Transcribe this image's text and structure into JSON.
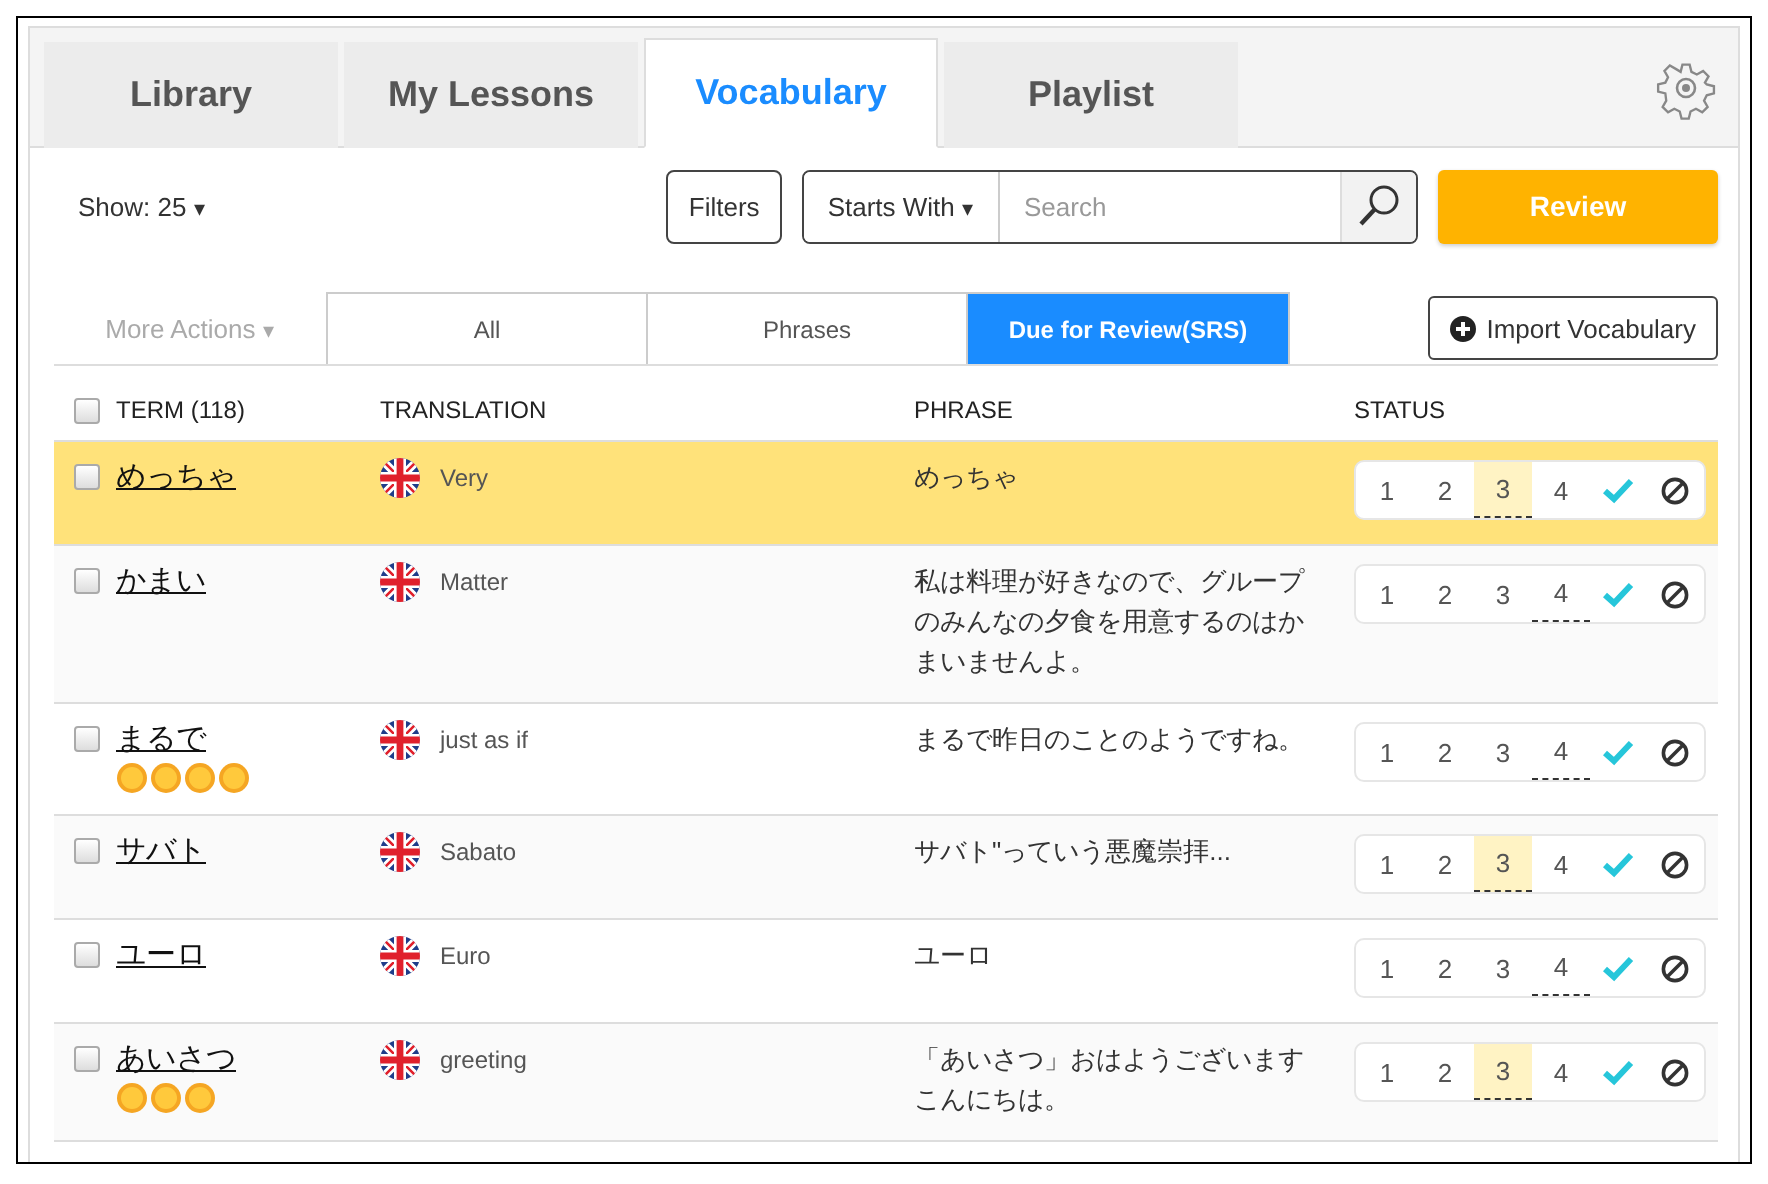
{
  "tabs": [
    {
      "label": "Library",
      "selected": false
    },
    {
      "label": "My Lessons",
      "selected": false
    },
    {
      "label": "Vocabulary",
      "selected": true
    },
    {
      "label": "Playlist",
      "selected": false
    }
  ],
  "toolbar": {
    "show": "Show: 25",
    "show_caret": "▾",
    "filters": "Filters",
    "match_mode": "Starts With",
    "match_caret": "▾",
    "search_placeholder": "Search",
    "review": "Review"
  },
  "actions": {
    "more_actions": "More Actions",
    "more_caret": "▾",
    "filter_tabs": [
      {
        "label": "All",
        "selected": false
      },
      {
        "label": "Phrases",
        "selected": false
      },
      {
        "label": "Due for Review(SRS)",
        "selected": true
      }
    ],
    "import": "Import Vocabulary"
  },
  "table": {
    "columns": [
      "TERM (118)",
      "TRANSLATION",
      "PHRASE",
      "STATUS"
    ],
    "all_checked": false,
    "rows": [
      {
        "term": "めっちゃ",
        "translation": "Very",
        "phrase": "めっちゃ",
        "checked": false,
        "highlighted": true,
        "levels": [
          {
            "label": "1",
            "selected": false,
            "underlined": false
          },
          {
            "label": "2",
            "selected": false,
            "underlined": false
          },
          {
            "label": "3",
            "selected": true,
            "underlined": true
          },
          {
            "label": "4",
            "selected": false,
            "underlined": false
          }
        ]
      },
      {
        "term": "かまい",
        "translation": "Matter",
        "phrase": "私は料理が好きなので、グループのみんなの夕食を用意するのはかまいませんよ。",
        "checked": false,
        "highlighted": false,
        "levels": [
          {
            "label": "1",
            "selected": false,
            "underlined": false
          },
          {
            "label": "2",
            "selected": false,
            "underlined": false
          },
          {
            "label": "3",
            "selected": false,
            "underlined": false
          },
          {
            "label": "4",
            "selected": false,
            "underlined": true
          }
        ]
      },
      {
        "term": "まるで",
        "translation": "just as if",
        "phrase": "まるで昨日のことのようですね。",
        "checked": false,
        "highlighted": false,
        "stars": 4,
        "levels": [
          {
            "label": "1",
            "selected": false,
            "underlined": false
          },
          {
            "label": "2",
            "selected": false,
            "underlined": false
          },
          {
            "label": "3",
            "selected": false,
            "underlined": false
          },
          {
            "label": "4",
            "selected": false,
            "underlined": true
          }
        ]
      },
      {
        "term": "サバト",
        "translation": "Sabato",
        "phrase": "サバト\"っていう悪魔崇拝...",
        "checked": false,
        "highlighted": false,
        "levels": [
          {
            "label": "1",
            "selected": false,
            "underlined": false
          },
          {
            "label": "2",
            "selected": false,
            "underlined": false
          },
          {
            "label": "3",
            "selected": true,
            "underlined": true
          },
          {
            "label": "4",
            "selected": false,
            "underlined": false
          }
        ]
      },
      {
        "term": "ユーロ",
        "translation": "Euro",
        "phrase": "ユーロ",
        "checked": false,
        "highlighted": false,
        "levels": [
          {
            "label": "1",
            "selected": false,
            "underlined": false
          },
          {
            "label": "2",
            "selected": false,
            "underlined": false
          },
          {
            "label": "3",
            "selected": false,
            "underlined": false
          },
          {
            "label": "4",
            "selected": false,
            "underlined": true
          }
        ]
      },
      {
        "term": "あいさつ",
        "translation": "greeting",
        "phrase": "「あいさつ」おはようございますこんにちは。",
        "checked": false,
        "highlighted": false,
        "stars": 3,
        "levels": [
          {
            "label": "1",
            "selected": false,
            "underlined": false
          },
          {
            "label": "2",
            "selected": false,
            "underlined": false
          },
          {
            "label": "3",
            "selected": true,
            "underlined": true
          },
          {
            "label": "4",
            "selected": false,
            "underlined": false
          }
        ]
      }
    ]
  }
}
